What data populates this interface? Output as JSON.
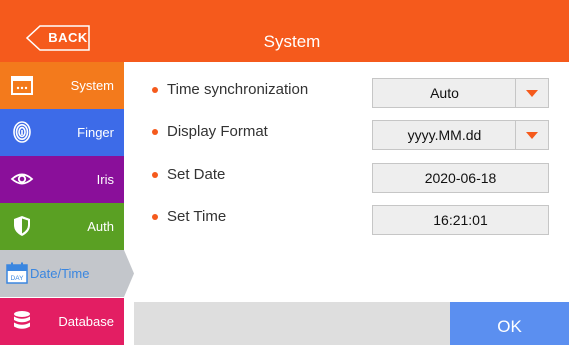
{
  "header": {
    "back_label": "BACK",
    "title": "System"
  },
  "sidebar": {
    "items": [
      {
        "label": "System",
        "color": "#f37a1c",
        "icon": "window-icon"
      },
      {
        "label": "Finger",
        "color": "#3d6be8",
        "icon": "fingerprint-icon"
      },
      {
        "label": "Iris",
        "color": "#8a0f9a",
        "icon": "eye-icon"
      },
      {
        "label": "Auth",
        "color": "#5aa023",
        "icon": "shield-icon"
      },
      {
        "label": "Date/Time",
        "color": "#c3c6cb",
        "icon": "calendar-icon",
        "icon_text": "DAY",
        "selected": true
      },
      {
        "label": "Database",
        "color": "#e31e63",
        "icon": "database-icon"
      }
    ]
  },
  "settings": {
    "time_sync": {
      "label": "Time synchronization",
      "value": "Auto"
    },
    "display_format": {
      "label": "Display Format",
      "value": "yyyy.MM.dd"
    },
    "set_date": {
      "label": "Set Date",
      "value": "2020-06-18"
    },
    "set_time": {
      "label": "Set Time",
      "value": "16:21:01"
    }
  },
  "footer": {
    "ok_label": "OK"
  },
  "colors": {
    "accent": "#f55a1c",
    "ok": "#5b8ff0"
  }
}
